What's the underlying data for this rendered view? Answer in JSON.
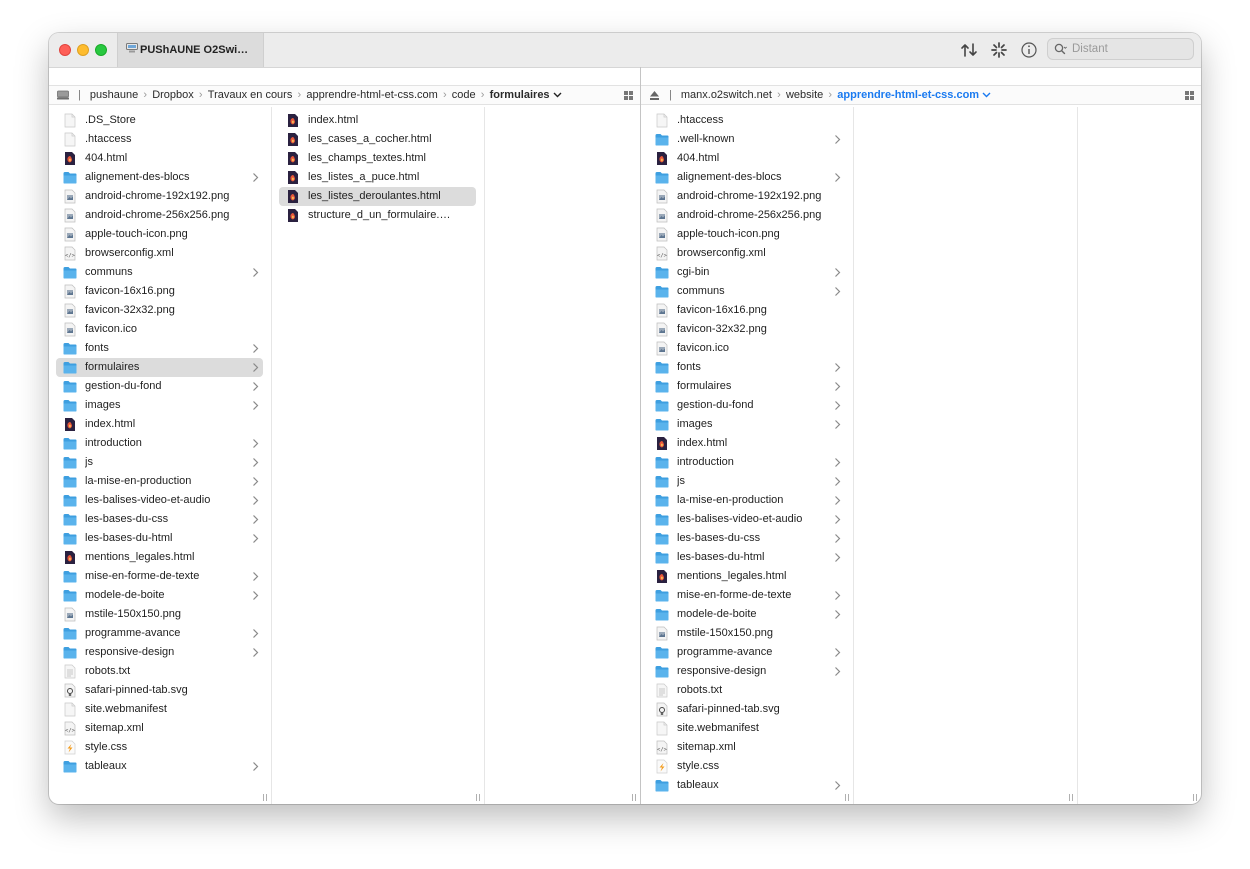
{
  "window": {
    "tab_title": "PUShAUNE O2Swi…"
  },
  "search": {
    "placeholder": "Distant"
  },
  "left": {
    "breadcrumbs": [
      "pushaune",
      "Dropbox",
      "Travaux en cours",
      "apprendre-html-et-css.com",
      "code"
    ],
    "current": "formulaires",
    "col1": [
      {
        "name": ".DS_Store",
        "kind": "blank",
        "folder": false
      },
      {
        "name": ".htaccess",
        "kind": "blank",
        "folder": false
      },
      {
        "name": "404.html",
        "kind": "html",
        "folder": false
      },
      {
        "name": "alignement-des-blocs",
        "kind": "folder",
        "folder": true
      },
      {
        "name": "android-chrome-192x192.png",
        "kind": "png",
        "folder": false
      },
      {
        "name": "android-chrome-256x256.png",
        "kind": "png",
        "folder": false
      },
      {
        "name": "apple-touch-icon.png",
        "kind": "png",
        "folder": false
      },
      {
        "name": "browserconfig.xml",
        "kind": "xml",
        "folder": false
      },
      {
        "name": "communs",
        "kind": "folder",
        "folder": true
      },
      {
        "name": "favicon-16x16.png",
        "kind": "png",
        "folder": false
      },
      {
        "name": "favicon-32x32.png",
        "kind": "png",
        "folder": false
      },
      {
        "name": "favicon.ico",
        "kind": "png",
        "folder": false
      },
      {
        "name": "fonts",
        "kind": "folder",
        "folder": true
      },
      {
        "name": "formulaires",
        "kind": "folder",
        "folder": true,
        "selected": true
      },
      {
        "name": "gestion-du-fond",
        "kind": "folder",
        "folder": true
      },
      {
        "name": "images",
        "kind": "folder",
        "folder": true
      },
      {
        "name": "index.html",
        "kind": "html",
        "folder": false
      },
      {
        "name": "introduction",
        "kind": "folder",
        "folder": true
      },
      {
        "name": "js",
        "kind": "folder",
        "folder": true
      },
      {
        "name": "la-mise-en-production",
        "kind": "folder",
        "folder": true
      },
      {
        "name": "les-balises-video-et-audio",
        "kind": "folder",
        "folder": true
      },
      {
        "name": "les-bases-du-css",
        "kind": "folder",
        "folder": true
      },
      {
        "name": "les-bases-du-html",
        "kind": "folder",
        "folder": true
      },
      {
        "name": "mentions_legales.html",
        "kind": "html",
        "folder": false
      },
      {
        "name": "mise-en-forme-de-texte",
        "kind": "folder",
        "folder": true
      },
      {
        "name": "modele-de-boite",
        "kind": "folder",
        "folder": true
      },
      {
        "name": "mstile-150x150.png",
        "kind": "png",
        "folder": false
      },
      {
        "name": "programme-avance",
        "kind": "folder",
        "folder": true
      },
      {
        "name": "responsive-design",
        "kind": "folder",
        "folder": true
      },
      {
        "name": "robots.txt",
        "kind": "txt",
        "folder": false
      },
      {
        "name": "safari-pinned-tab.svg",
        "kind": "svg",
        "folder": false
      },
      {
        "name": "site.webmanifest",
        "kind": "blank",
        "folder": false
      },
      {
        "name": "sitemap.xml",
        "kind": "xml",
        "folder": false
      },
      {
        "name": "style.css",
        "kind": "css",
        "folder": false
      },
      {
        "name": "tableaux",
        "kind": "folder",
        "folder": true
      }
    ],
    "col2": [
      {
        "name": "index.html",
        "kind": "html",
        "folder": false
      },
      {
        "name": "les_cases_a_cocher.html",
        "kind": "html",
        "folder": false
      },
      {
        "name": "les_champs_textes.html",
        "kind": "html",
        "folder": false
      },
      {
        "name": "les_listes_a_puce.html",
        "kind": "html",
        "folder": false
      },
      {
        "name": "les_listes_deroulantes.html",
        "kind": "html",
        "folder": false,
        "selected": true
      },
      {
        "name": "structure_d_un_formulaire.ht…",
        "kind": "html",
        "folder": false
      }
    ]
  },
  "right": {
    "breadcrumbs": [
      "manx.o2switch.net",
      "website"
    ],
    "current": "apprendre-html-et-css.com",
    "col1": [
      {
        "name": ".htaccess",
        "kind": "blank",
        "folder": false
      },
      {
        "name": ".well-known",
        "kind": "folder",
        "folder": true
      },
      {
        "name": "404.html",
        "kind": "html",
        "folder": false
      },
      {
        "name": "alignement-des-blocs",
        "kind": "folder",
        "folder": true
      },
      {
        "name": "android-chrome-192x192.png",
        "kind": "png",
        "folder": false
      },
      {
        "name": "android-chrome-256x256.png",
        "kind": "png",
        "folder": false
      },
      {
        "name": "apple-touch-icon.png",
        "kind": "png",
        "folder": false
      },
      {
        "name": "browserconfig.xml",
        "kind": "xml",
        "folder": false
      },
      {
        "name": "cgi-bin",
        "kind": "folder",
        "folder": true
      },
      {
        "name": "communs",
        "kind": "folder",
        "folder": true
      },
      {
        "name": "favicon-16x16.png",
        "kind": "png",
        "folder": false
      },
      {
        "name": "favicon-32x32.png",
        "kind": "png",
        "folder": false
      },
      {
        "name": "favicon.ico",
        "kind": "png",
        "folder": false
      },
      {
        "name": "fonts",
        "kind": "folder",
        "folder": true
      },
      {
        "name": "formulaires",
        "kind": "folder",
        "folder": true
      },
      {
        "name": "gestion-du-fond",
        "kind": "folder",
        "folder": true
      },
      {
        "name": "images",
        "kind": "folder",
        "folder": true
      },
      {
        "name": "index.html",
        "kind": "html",
        "folder": false
      },
      {
        "name": "introduction",
        "kind": "folder",
        "folder": true
      },
      {
        "name": "js",
        "kind": "folder",
        "folder": true
      },
      {
        "name": "la-mise-en-production",
        "kind": "folder",
        "folder": true
      },
      {
        "name": "les-balises-video-et-audio",
        "kind": "folder",
        "folder": true
      },
      {
        "name": "les-bases-du-css",
        "kind": "folder",
        "folder": true
      },
      {
        "name": "les-bases-du-html",
        "kind": "folder",
        "folder": true
      },
      {
        "name": "mentions_legales.html",
        "kind": "html",
        "folder": false
      },
      {
        "name": "mise-en-forme-de-texte",
        "kind": "folder",
        "folder": true
      },
      {
        "name": "modele-de-boite",
        "kind": "folder",
        "folder": true
      },
      {
        "name": "mstile-150x150.png",
        "kind": "png",
        "folder": false
      },
      {
        "name": "programme-avance",
        "kind": "folder",
        "folder": true
      },
      {
        "name": "responsive-design",
        "kind": "folder",
        "folder": true
      },
      {
        "name": "robots.txt",
        "kind": "txt",
        "folder": false
      },
      {
        "name": "safari-pinned-tab.svg",
        "kind": "svg",
        "folder": false
      },
      {
        "name": "site.webmanifest",
        "kind": "blank",
        "folder": false
      },
      {
        "name": "sitemap.xml",
        "kind": "xml",
        "folder": false
      },
      {
        "name": "style.css",
        "kind": "css",
        "folder": false
      },
      {
        "name": "tableaux",
        "kind": "folder",
        "folder": true
      }
    ]
  },
  "colors": {
    "folder": "#5ab3ec",
    "folder_tab": "#3e9fe0",
    "html_icon": "#2a2140",
    "html_accent": "#e8563a",
    "selection": "#dcdcdc",
    "accent_blue": "#1a7af0"
  }
}
